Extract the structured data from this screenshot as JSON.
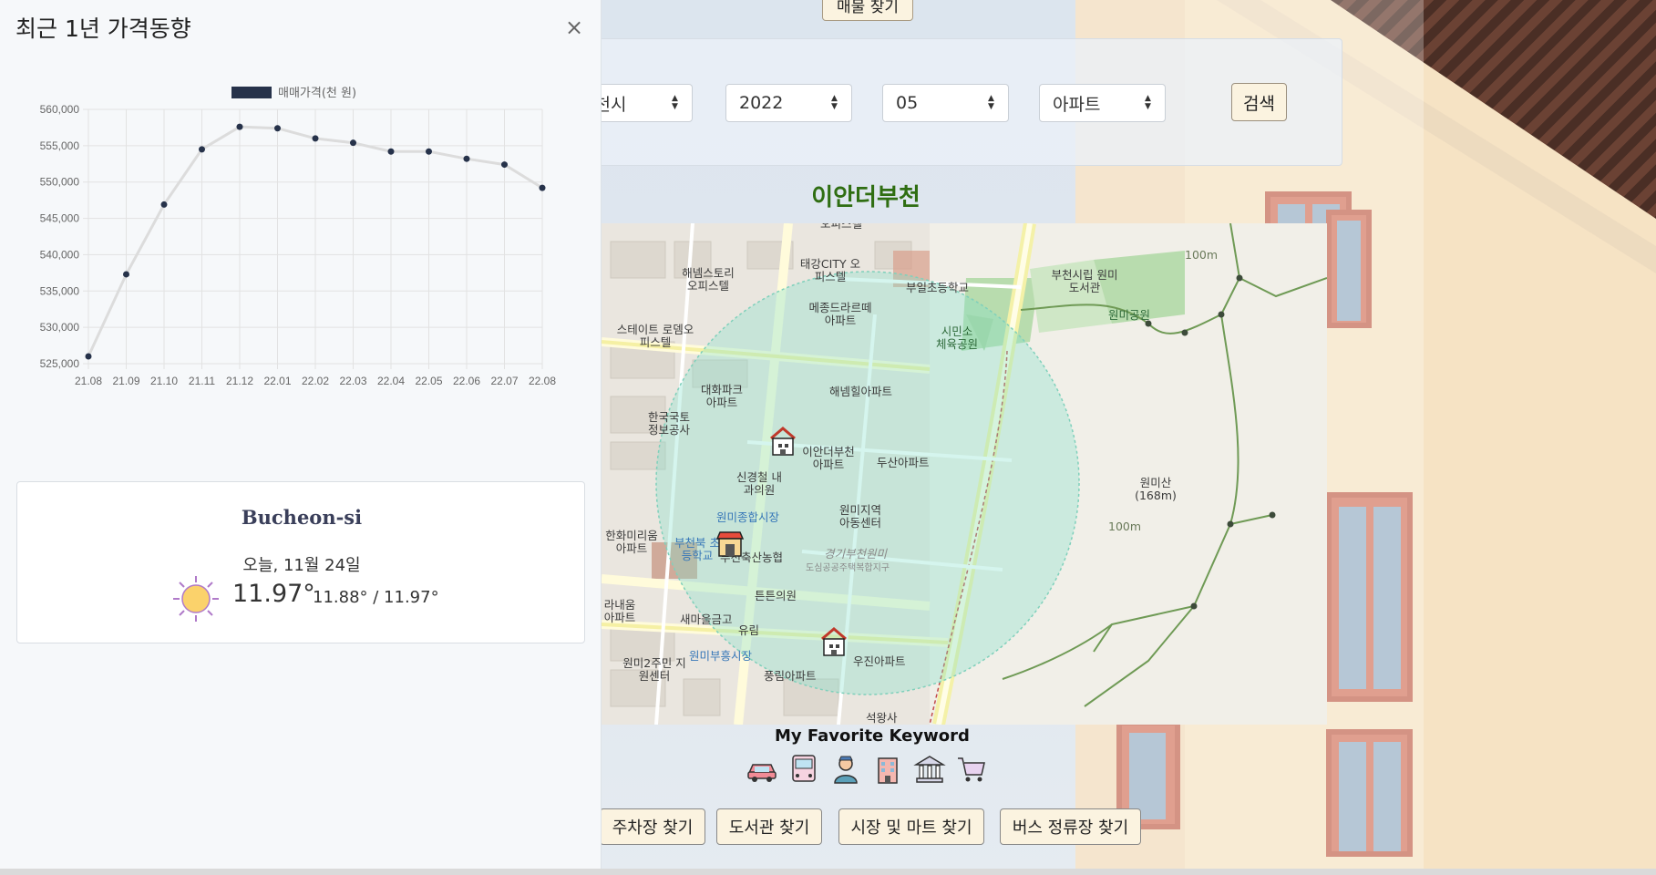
{
  "top": {
    "find_property_label": "매물 찾기"
  },
  "search": {
    "city": "부천시",
    "year": "2022",
    "month": "05",
    "type": "아파트",
    "search_label": "검색"
  },
  "apartment": {
    "name": "이안더부천"
  },
  "map": {
    "labels": [
      "오피스텔",
      "태강CITY 오피스텔",
      "해넴스토리 오피스텔",
      "부일초등학교",
      "부천시립 원미도서관",
      "원미공원",
      "메종드라르떼 아파트",
      "스테이트 로뎀오피스텔",
      "시민소 체육공원",
      "대화파크 아파트",
      "해넴힐아파트",
      "한국국토 정보공사",
      "이안더부천 아파트",
      "두산아파트",
      "신경철 내과의원",
      "원미산 (168m)",
      "원미종합시장",
      "원미지역 아동센터",
      "한화미리움 아파트",
      "부천북 초등학교",
      "부천축산농협",
      "경기부천원미",
      "도심공공주택복합지구",
      "튼튼의원",
      "라내움 아파트",
      "새마을금고",
      "유림",
      "원미2주민 지원센터",
      "원미부흥시장",
      "우진아파트",
      "풍림아파트",
      "석왕사",
      "100m",
      "100m"
    ]
  },
  "favorites": {
    "title": "My Favorite Keyword",
    "icons": [
      "car-icon",
      "bus-icon",
      "person-icon",
      "building-icon",
      "library-icon",
      "cart-icon"
    ],
    "buttons": [
      "주차장 찾기",
      "도서관 찾기",
      "시장 및 마트 찾기",
      "버스 정류장 찾기"
    ]
  },
  "sidebar": {
    "title": "최근 1년 가격동향",
    "close": "×"
  },
  "chart_data": {
    "type": "line",
    "title": "",
    "legend": "매매가격(천 원)",
    "legend_position": "top",
    "categories": [
      "21.08",
      "21.09",
      "21.10",
      "21.11",
      "21.12",
      "22.01",
      "22.02",
      "22.03",
      "22.04",
      "22.05",
      "22.06",
      "22.07",
      "22.08"
    ],
    "series": [
      {
        "name": "매매가격(천 원)",
        "values": [
          526000,
          537300,
          546900,
          554500,
          557600,
          557400,
          556000,
          555400,
          554200,
          554200,
          553200,
          552400,
          549200
        ]
      }
    ],
    "ylim": [
      525000,
      560000
    ],
    "yticks": [
      "560,000",
      "555,000",
      "550,000",
      "545,000",
      "540,000",
      "535,000",
      "530,000",
      "525,000"
    ],
    "grid": true,
    "line_color": "#dcdcdc",
    "point_color": "#26324a"
  },
  "weather": {
    "city": "Bucheon-si",
    "date": "오늘, 11월 24일",
    "temp": "11.97°",
    "range": "11.88° / 11.97°",
    "icon": "sun-icon"
  }
}
